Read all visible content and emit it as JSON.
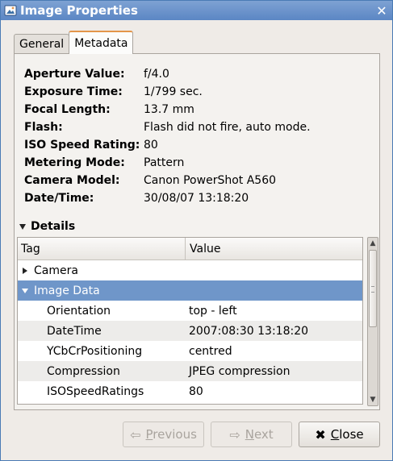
{
  "window": {
    "title": "Image Properties"
  },
  "tabs": [
    {
      "label": "General"
    },
    {
      "label": "Metadata"
    }
  ],
  "metadata": [
    {
      "key": "Aperture Value:",
      "value": "f/4.0"
    },
    {
      "key": "Exposure Time:",
      "value": "1/799 sec."
    },
    {
      "key": "Focal Length:",
      "value": "13.7 mm"
    },
    {
      "key": "Flash:",
      "value": "Flash did not fire, auto mode."
    },
    {
      "key": "ISO Speed Rating:",
      "value": "80"
    },
    {
      "key": "Metering Mode:",
      "value": "Pattern"
    },
    {
      "key": "Camera Model:",
      "value": "Canon PowerShot A560"
    },
    {
      "key": "Date/Time:",
      "value": "30/08/07 13:18:20"
    }
  ],
  "details": {
    "label": "Details",
    "columns": {
      "tag": "Tag",
      "value": "Value"
    },
    "groups": [
      {
        "label": "Camera"
      },
      {
        "label": "Image Data"
      }
    ],
    "rows": [
      {
        "tag": "Orientation",
        "value": "top - left"
      },
      {
        "tag": "DateTime",
        "value": "2007:08:30 13:18:20"
      },
      {
        "tag": "YCbCrPositioning",
        "value": "centred"
      },
      {
        "tag": "Compression",
        "value": "JPEG compression"
      },
      {
        "tag": "ISOSpeedRatings",
        "value": "80"
      }
    ]
  },
  "buttons": {
    "previous": {
      "first": "P",
      "rest": "revious"
    },
    "next": {
      "first": "N",
      "rest": "ext"
    },
    "close": {
      "first": "C",
      "rest": "lose"
    }
  },
  "colors": {
    "titlebar": "#5b86c4",
    "selection": "#6f96c9",
    "tab_accent": "#e4954a"
  }
}
